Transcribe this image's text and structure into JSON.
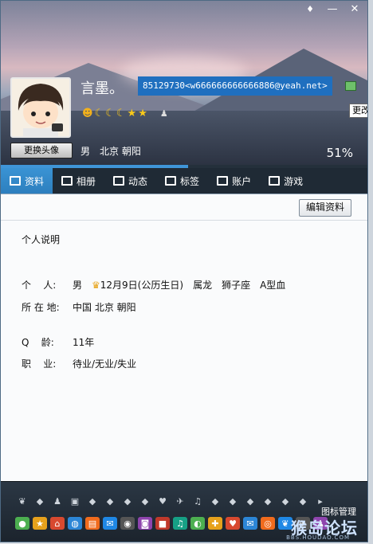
{
  "window": {
    "controls": [
      "skin",
      "minimize",
      "close"
    ]
  },
  "header": {
    "nickname": "言墨。",
    "email": "85129730<w666666666666886@yeah.net>",
    "tooltip": "更改",
    "change_avatar_label": "更换头像",
    "gender": "男",
    "location": "北京 朝阳",
    "completion": "51%",
    "completion_value": 0.51,
    "level_icons": [
      "sun",
      "moon",
      "moon",
      "moon",
      "star",
      "star"
    ],
    "pet_icon": "penguin-icon"
  },
  "tabs": [
    {
      "label": "资料",
      "icon": "card-icon",
      "active": true
    },
    {
      "label": "相册",
      "icon": "photo-icon",
      "active": false
    },
    {
      "label": "动态",
      "icon": "list-icon",
      "active": false
    },
    {
      "label": "标签",
      "icon": "bookmark-icon",
      "active": false
    },
    {
      "label": "账户",
      "icon": "briefcase-icon",
      "active": false
    },
    {
      "label": "游戏",
      "icon": "game-icon",
      "active": false
    }
  ],
  "profile": {
    "edit_button": "编辑资料",
    "section_title": "个人说明",
    "rows": [
      {
        "label": "个    人:",
        "values": [
          "男",
          "12月9日(公历生日)",
          "属龙",
          "狮子座",
          "A型血"
        ]
      },
      {
        "label": "所 在 地:",
        "values": [
          "中国 北京 朝阳"
        ]
      },
      {
        "label": "Q    龄:",
        "values": [
          "11年"
        ]
      },
      {
        "label": "职    业:",
        "values": [
          "待业/无业/失业"
        ]
      }
    ]
  },
  "bottom_bar": {
    "row1_icons": [
      "leaf-icon",
      "diamond-icon",
      "penguin-icon",
      "computer-icon",
      "diamond-icon",
      "diamond-icon",
      "diamond-icon",
      "diamond-icon",
      "heart-icon",
      "bird-icon",
      "music-icon",
      "diamond-icon",
      "diamond-icon",
      "diamond-icon",
      "diamond-icon",
      "diamond-icon",
      "diamond-icon",
      "arrow-icon"
    ],
    "row2_icons": [
      "chat-icon",
      "star-icon",
      "house-icon",
      "globe-icon",
      "bag-icon",
      "mail-icon",
      "qq-icon",
      "camera-icon",
      "box-icon",
      "music-icon",
      "ball-icon",
      "gift-icon",
      "heart-icon",
      "mail-icon",
      "drum-icon",
      "leaf-icon",
      "bird-icon",
      "penguin-icon"
    ],
    "manager_label": "图标管理",
    "watermark": "猴岛论坛",
    "watermark_sub": "BBS.HOUDAO.COM"
  },
  "colors": {
    "tab_bar": "#1f2a35",
    "tab_active": "#3a93d4",
    "email_highlight": "#1f6fbf",
    "progress": "#3f95d8"
  }
}
